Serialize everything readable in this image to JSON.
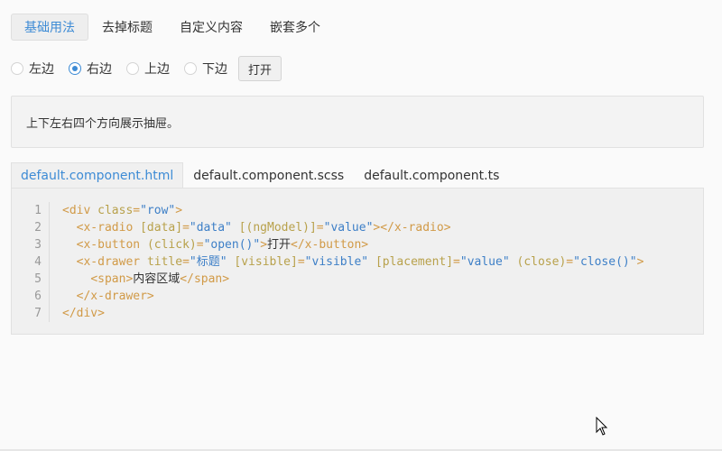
{
  "top_tabs": [
    "基础用法",
    "去掉标题",
    "自定义内容",
    "嵌套多个"
  ],
  "radios": [
    {
      "label": "左边",
      "checked": false
    },
    {
      "label": "右边",
      "checked": true
    },
    {
      "label": "上边",
      "checked": false
    },
    {
      "label": "下边",
      "checked": false
    }
  ],
  "open_button": "打开",
  "description": "上下左右四个方向展示抽屉。",
  "code_tabs": [
    "default.component.html",
    "default.component.scss",
    "default.component.ts"
  ],
  "code_lines": [
    {
      "num": "1",
      "tokens": [
        [
          "tag",
          "<div "
        ],
        [
          "attr",
          "class"
        ],
        [
          "tag",
          "="
        ],
        [
          "str",
          "\"row\""
        ],
        [
          "tag",
          ">"
        ]
      ]
    },
    {
      "num": "2",
      "tokens": [
        [
          "txt",
          "  "
        ],
        [
          "tag",
          "<x-radio "
        ],
        [
          "attr",
          "[data]"
        ],
        [
          "tag",
          "="
        ],
        [
          "str",
          "\"data\""
        ],
        [
          "txt",
          " "
        ],
        [
          "attr",
          "[(ngModel)]"
        ],
        [
          "tag",
          "="
        ],
        [
          "str",
          "\"value\""
        ],
        [
          "tag",
          "></x-radio>"
        ]
      ]
    },
    {
      "num": "3",
      "tokens": [
        [
          "txt",
          "  "
        ],
        [
          "tag",
          "<x-button "
        ],
        [
          "attr",
          "(click)"
        ],
        [
          "tag",
          "="
        ],
        [
          "str",
          "\"open()\""
        ],
        [
          "tag",
          ">"
        ],
        [
          "txt",
          "打开"
        ],
        [
          "tag",
          "</x-button>"
        ]
      ]
    },
    {
      "num": "4",
      "tokens": [
        [
          "txt",
          "  "
        ],
        [
          "tag",
          "<x-drawer "
        ],
        [
          "attr",
          "title"
        ],
        [
          "tag",
          "="
        ],
        [
          "str",
          "\"标题\""
        ],
        [
          "txt",
          " "
        ],
        [
          "attr",
          "[visible]"
        ],
        [
          "tag",
          "="
        ],
        [
          "str",
          "\"visible\""
        ],
        [
          "txt",
          " "
        ],
        [
          "attr",
          "[placement]"
        ],
        [
          "tag",
          "="
        ],
        [
          "str",
          "\"value\""
        ],
        [
          "txt",
          " "
        ],
        [
          "attr",
          "(close)"
        ],
        [
          "tag",
          "="
        ],
        [
          "str",
          "\"close()\""
        ],
        [
          "tag",
          ">"
        ]
      ]
    },
    {
      "num": "5",
      "tokens": [
        [
          "txt",
          "    "
        ],
        [
          "tag",
          "<span>"
        ],
        [
          "txt",
          "内容区域"
        ],
        [
          "tag",
          "</span>"
        ]
      ]
    },
    {
      "num": "6",
      "tokens": [
        [
          "txt",
          "  "
        ],
        [
          "tag",
          "</x-drawer>"
        ]
      ]
    },
    {
      "num": "7",
      "tokens": [
        [
          "tag",
          "</div>"
        ]
      ]
    }
  ],
  "colors": {
    "accent": "#3d8bd5",
    "tag": "#d19a47",
    "attr": "#b8a14b",
    "string": "#3d7fc7"
  }
}
